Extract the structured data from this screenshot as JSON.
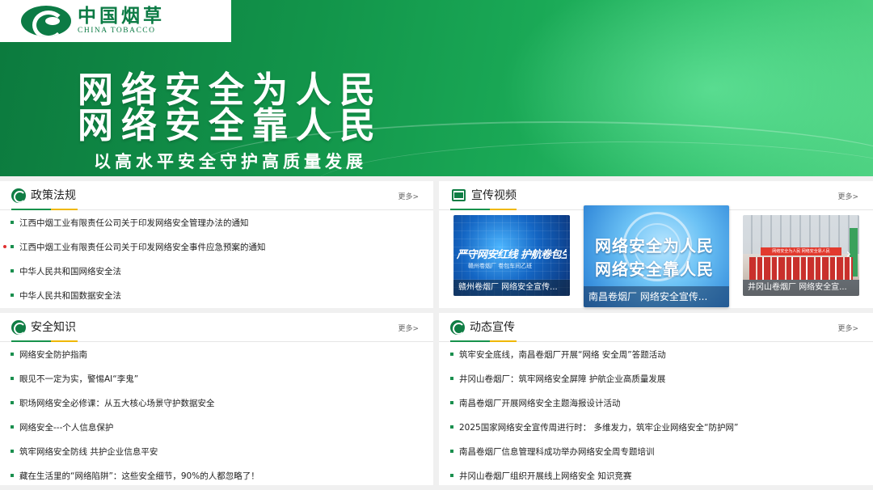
{
  "logo": {
    "cn": "中国烟草",
    "en": "CHINA TOBACCO"
  },
  "banner": {
    "line1": "网络安全为人民",
    "line2": "网络安全靠人民",
    "line3": "以高水平安全守护高质量发展"
  },
  "colors": {
    "brand_green": "#0c7b45",
    "accent_gold": "#f0b800",
    "bullet_green": "#1a8f4e",
    "marker_red": "#e03030"
  },
  "policy": {
    "title": "政策法规",
    "more": "更多>",
    "items": [
      "江西中烟工业有限责任公司关于印发网络安全管理办法的通知",
      "江西中烟工业有限责任公司关于印发网络安全事件应急预案的通知",
      "中华人民共和国网络安全法",
      "中华人民共和国数据安全法"
    ]
  },
  "video": {
    "title": "宣传视频",
    "more": "更多>",
    "cards": [
      {
        "caption": "赣州卷烟厂 网络安全宣传...",
        "line1": "严守网安红线 护航卷包生产",
        "line2": "赣州卷烟厂 卷包车间乙班"
      },
      {
        "caption": "南昌卷烟厂 网络安全宣传...",
        "line1": "网络安全为人民",
        "line2": "网络安全靠人民"
      },
      {
        "caption": "井冈山卷烟厂 网络安全宣...",
        "line1": "网络安全为人民 网络安全靠人民"
      }
    ]
  },
  "knowledge": {
    "title": "安全知识",
    "more": "更多>",
    "items": [
      "网络安全防护指南",
      "眼见不一定为实，警惕AI“李鬼”",
      "职场网络安全必修课：从五大核心场景守护数据安全",
      "网络安全---个人信息保护",
      "筑牢网络安全防线 共护企业信息平安",
      "藏在生活里的“网络陷阱”：这些安全细节，90%的人都忽略了！"
    ]
  },
  "news": {
    "title": "动态宣传",
    "more": "更多>",
    "items": [
      "筑牢安全底线，南昌卷烟厂开展“网络 安全周”答题活动",
      "井冈山卷烟厂：筑牢网络安全屏障 护航企业高质量发展",
      "南昌卷烟厂开展网络安全主题海报设计活动",
      "2025国家网络安全宣传周进行时： 多维发力，筑牢企业网络安全“防护网”",
      "南昌卷烟厂信息管理科成功举办网络安全周专题培训",
      "井冈山卷烟厂组织开展线上网络安全 知识竞赛"
    ]
  }
}
